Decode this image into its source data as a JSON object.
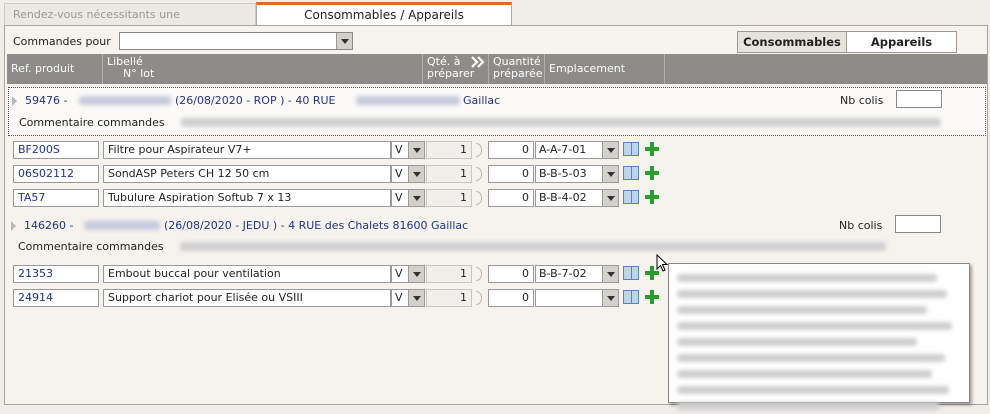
{
  "tabs": [
    "Rendez-vous nécessitants une préparation",
    "Consommables / Appareils"
  ],
  "filter": {
    "label": "Commandes pour",
    "value": ""
  },
  "segments": [
    "Consommables",
    "Appareils"
  ],
  "columns": {
    "ref": "Ref. produit",
    "libelle": "Libellé",
    "nlot": "N° lot",
    "qte": "Qté. à préparer",
    "qte_line2": "préparer",
    "qprep": "Quantité préparée",
    "qprep_line2": "préparée",
    "emplacement": "Emplacement"
  },
  "orders": [
    {
      "num": "59476 -",
      "details": "(26/08/2020 - ROP )  - 40 RUE",
      "city": "Gaillac",
      "nb_colis_label": "Nb colis",
      "comment_label": "Commentaire commandes",
      "lines": [
        {
          "ref": "BF200S",
          "libelle": "Filtre pour Aspirateur V7+",
          "v": "V",
          "qte": "1",
          "qprep": "0",
          "emplacement": "A-A-7-01"
        },
        {
          "ref": "06S02112",
          "libelle": "SondASP Peters CH 12 50 cm",
          "v": "V",
          "qte": "1",
          "qprep": "0",
          "emplacement": "B-B-5-03"
        },
        {
          "ref": "TA57",
          "libelle": "Tubulure Aspiration Softub 7 x 13",
          "v": "V",
          "qte": "1",
          "qprep": "0",
          "emplacement": "B-B-4-02"
        }
      ]
    },
    {
      "num": "146260 -",
      "details": "(26/08/2020 - JEDU )  - 4 RUE des Chalets 81600 Gaillac",
      "city": "",
      "nb_colis_label": "Nb colis",
      "comment_label": "Commentaire commandes",
      "lines": [
        {
          "ref": "21353",
          "libelle": "Embout buccal pour ventilation",
          "v": "V",
          "qte": "1",
          "qprep": "0",
          "emplacement": "B-B-7-02"
        },
        {
          "ref": "24914",
          "libelle": "Support chariot pour Elisée ou  VSIII",
          "v": "V",
          "qte": "1",
          "qprep": "0",
          "emplacement": ""
        }
      ]
    }
  ],
  "icons": [
    "prepare-arrows-icon",
    "book-icon",
    "plus-icon",
    "dropdown-icon"
  ],
  "colors": {
    "accent": "#e06b2c",
    "header_bg": "#8e8c8a",
    "link": "#223388",
    "plus": "#2e9b2e"
  }
}
